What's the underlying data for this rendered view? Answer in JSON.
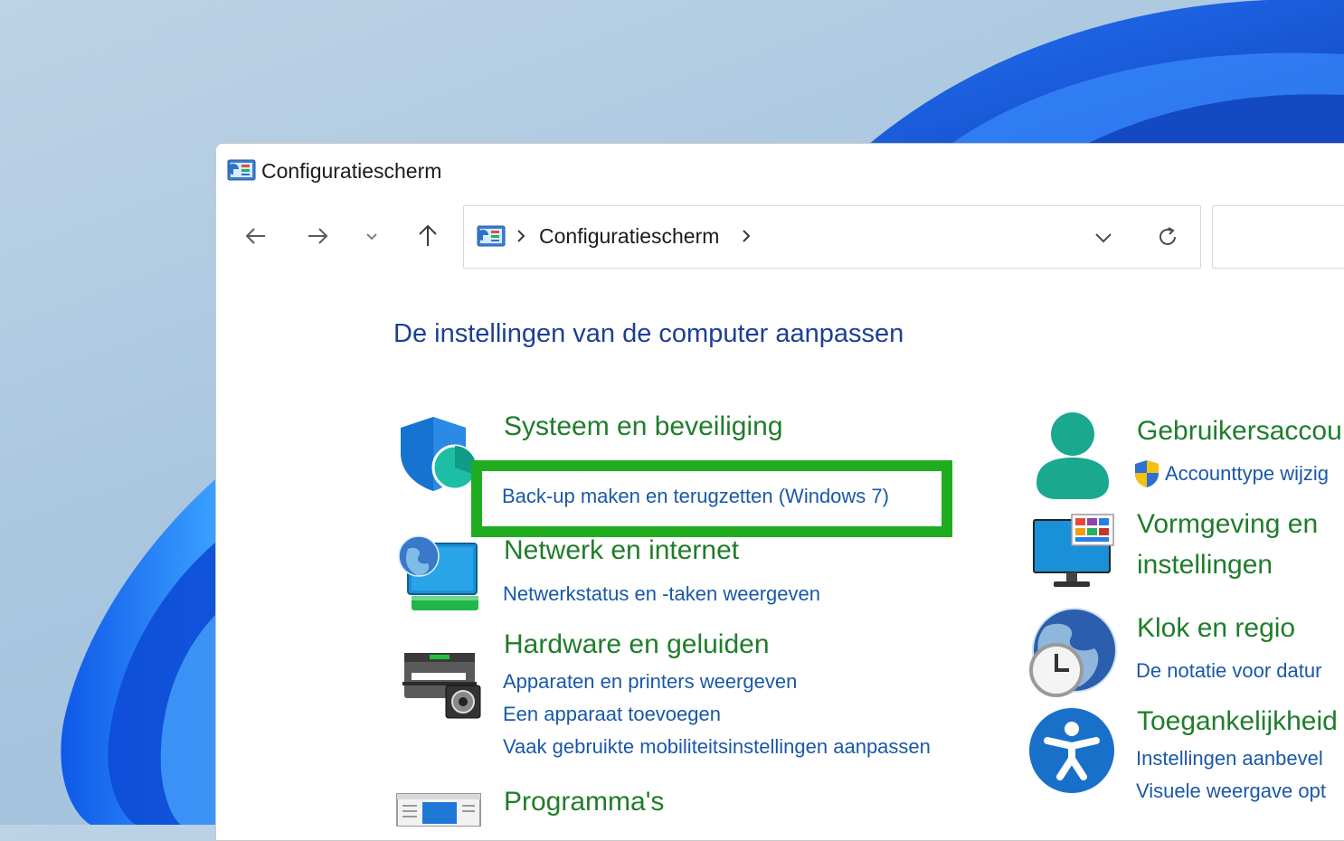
{
  "window": {
    "title": "Configuratiescherm"
  },
  "address": {
    "crumb": "Configuratiescherm"
  },
  "page": {
    "title": "De instellingen van de computer aanpassen"
  },
  "categories": {
    "system": {
      "title": "Systeem en beveiliging",
      "links": [
        "Back-up maken en terugzetten (Windows 7)"
      ]
    },
    "network": {
      "title": "Netwerk en internet",
      "links": [
        "Netwerkstatus en -taken weergeven"
      ]
    },
    "hardware": {
      "title": "Hardware en geluiden",
      "links": [
        "Apparaten en printers weergeven",
        "Een apparaat toevoegen",
        "Vaak gebruikte mobiliteitsinstellingen aanpassen"
      ]
    },
    "programs": {
      "title": "Programma's"
    },
    "users": {
      "title": "Gebruikersaccou",
      "links": [
        "Accounttype wijzig"
      ]
    },
    "appearance": {
      "title_line1": "Vormgeving en",
      "title_line2": "instellingen"
    },
    "clock": {
      "title": "Klok en regio",
      "links": [
        "De notatie voor datur"
      ]
    },
    "access": {
      "title": "Toegankelijkheid",
      "links": [
        "Instellingen aanbevel",
        "Visuele weergave opt"
      ]
    }
  },
  "colors": {
    "highlight": "#1fad1f",
    "link": "#1a58a8",
    "category": "#1f7d2b",
    "title": "#1c3f94"
  }
}
